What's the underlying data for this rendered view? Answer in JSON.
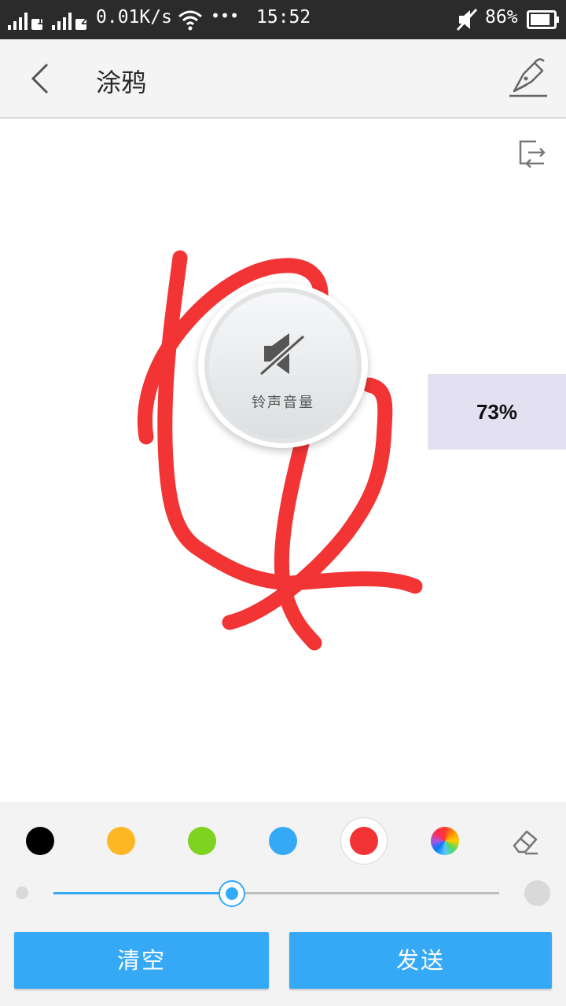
{
  "status_bar": {
    "sim1_badge": "1",
    "sim2_badge": "2",
    "network_speed": "0.01K/s",
    "more_indicator": "•••",
    "time": "15:52",
    "battery_percent": "86%",
    "battery_level": 0.86,
    "icons": [
      "signal-icon",
      "wifi-icon",
      "mute-icon",
      "battery-icon"
    ]
  },
  "header": {
    "title": "涂鸦",
    "back_icon": "chevron-left-icon",
    "pen_icon": "pen-signature-icon"
  },
  "canvas": {
    "switch_icon": "switch-screen-icon",
    "stroke_color": "#f23434"
  },
  "volume_toast": {
    "label": "铃声音量",
    "icon": "speaker-muted-icon",
    "percent": "73%"
  },
  "palette": {
    "colors": [
      {
        "name": "black",
        "hex": "#000000"
      },
      {
        "name": "orange",
        "hex": "#ffb624"
      },
      {
        "name": "green",
        "hex": "#7ed321"
      },
      {
        "name": "blue",
        "hex": "#36a9f6"
      },
      {
        "name": "red",
        "hex": "#f23434",
        "selected": true
      },
      {
        "name": "custom",
        "hex": "rainbow"
      }
    ],
    "eraser_icon": "eraser-icon"
  },
  "brush_size": {
    "value": 0.4
  },
  "buttons": {
    "clear_label": "清空",
    "send_label": "发送"
  },
  "accent_color": "#36a9f6"
}
